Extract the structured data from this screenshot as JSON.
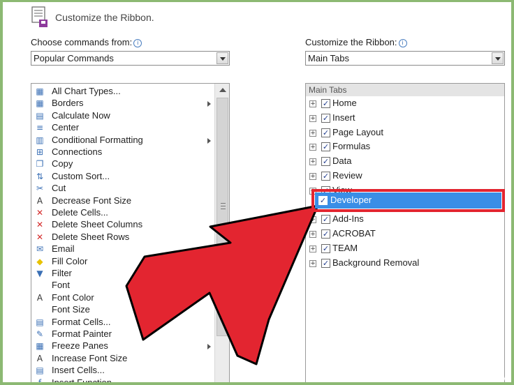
{
  "header": {
    "title": "Customize the Ribbon."
  },
  "left": {
    "label": "Choose commands from:",
    "dropdown_value": "Popular Commands",
    "items": [
      {
        "label": "All Chart Types...",
        "icon": "chart-icon",
        "glyph": "▦",
        "arrow": false
      },
      {
        "label": "Borders",
        "icon": "borders-icon",
        "glyph": "▦",
        "arrow": true
      },
      {
        "label": "Calculate Now",
        "icon": "calculator-icon",
        "glyph": "▤",
        "arrow": false
      },
      {
        "label": "Center",
        "icon": "align-center-icon",
        "glyph": "≡",
        "arrow": false
      },
      {
        "label": "Conditional Formatting",
        "icon": "conditional-formatting-icon",
        "glyph": "▥",
        "arrow": true
      },
      {
        "label": "Connections",
        "icon": "connections-icon",
        "glyph": "⊞",
        "arrow": false
      },
      {
        "label": "Copy",
        "icon": "copy-icon",
        "glyph": "❐",
        "arrow": false
      },
      {
        "label": "Custom Sort...",
        "icon": "sort-icon",
        "glyph": "⇅",
        "arrow": false
      },
      {
        "label": "Cut",
        "icon": "scissors-icon",
        "glyph": "✂",
        "arrow": false
      },
      {
        "label": "Decrease Font Size",
        "icon": "decrease-font-icon",
        "glyph": "A",
        "arrow": false
      },
      {
        "label": "Delete Cells...",
        "icon": "delete-cells-icon",
        "glyph": "✕",
        "arrow": false
      },
      {
        "label": "Delete Sheet Columns",
        "icon": "delete-columns-icon",
        "glyph": "✕",
        "arrow": false
      },
      {
        "label": "Delete Sheet Rows",
        "icon": "delete-rows-icon",
        "glyph": "✕",
        "arrow": false
      },
      {
        "label": "Email",
        "icon": "email-icon",
        "glyph": "✉",
        "arrow": false
      },
      {
        "label": "Fill Color",
        "icon": "fill-color-icon",
        "glyph": "◆",
        "arrow": false
      },
      {
        "label": "Filter",
        "icon": "filter-icon",
        "glyph": "▼",
        "arrow": false
      },
      {
        "label": "Font",
        "icon": "font-icon",
        "glyph": "",
        "arrow": false
      },
      {
        "label": "Font Color",
        "icon": "font-color-icon",
        "glyph": "A",
        "arrow": false
      },
      {
        "label": "Font Size",
        "icon": "font-size-icon",
        "glyph": "",
        "arrow": false
      },
      {
        "label": "Format Cells...",
        "icon": "format-cells-icon",
        "glyph": "▤",
        "arrow": false
      },
      {
        "label": "Format Painter",
        "icon": "format-painter-icon",
        "glyph": "✎",
        "arrow": false
      },
      {
        "label": "Freeze Panes",
        "icon": "freeze-panes-icon",
        "glyph": "▦",
        "arrow": true
      },
      {
        "label": "Increase Font Size",
        "icon": "increase-font-icon",
        "glyph": "A",
        "arrow": false
      },
      {
        "label": "Insert Cells...",
        "icon": "insert-cells-icon",
        "glyph": "▤",
        "arrow": false
      },
      {
        "label": "Insert Function...",
        "icon": "insert-function-icon",
        "glyph": "ƒ",
        "arrow": false
      }
    ]
  },
  "right": {
    "label": "Customize the Ribbon:",
    "dropdown_value": "Main Tabs",
    "tree_header": "Main Tabs",
    "tabs": [
      {
        "label": "Home",
        "checked": true
      },
      {
        "label": "Insert",
        "checked": true
      },
      {
        "label": "Page Layout",
        "checked": true
      },
      {
        "label": "Formulas",
        "checked": true
      },
      {
        "label": "Data",
        "checked": true
      },
      {
        "label": "Review",
        "checked": true
      },
      {
        "label": "View",
        "checked": true
      },
      {
        "label": "Developer",
        "checked": true,
        "selected": true
      },
      {
        "label": "Add-Ins",
        "checked": true
      },
      {
        "label": "ACROBAT",
        "checked": true
      },
      {
        "label": "TEAM",
        "checked": true
      },
      {
        "label": "Background Removal",
        "checked": true
      }
    ]
  },
  "colors": {
    "arrow": "#e32530",
    "highlight": "#3a8ee6",
    "border": "#8cb973"
  },
  "watermark": {
    "part1": "wiki",
    "part2": "How"
  }
}
